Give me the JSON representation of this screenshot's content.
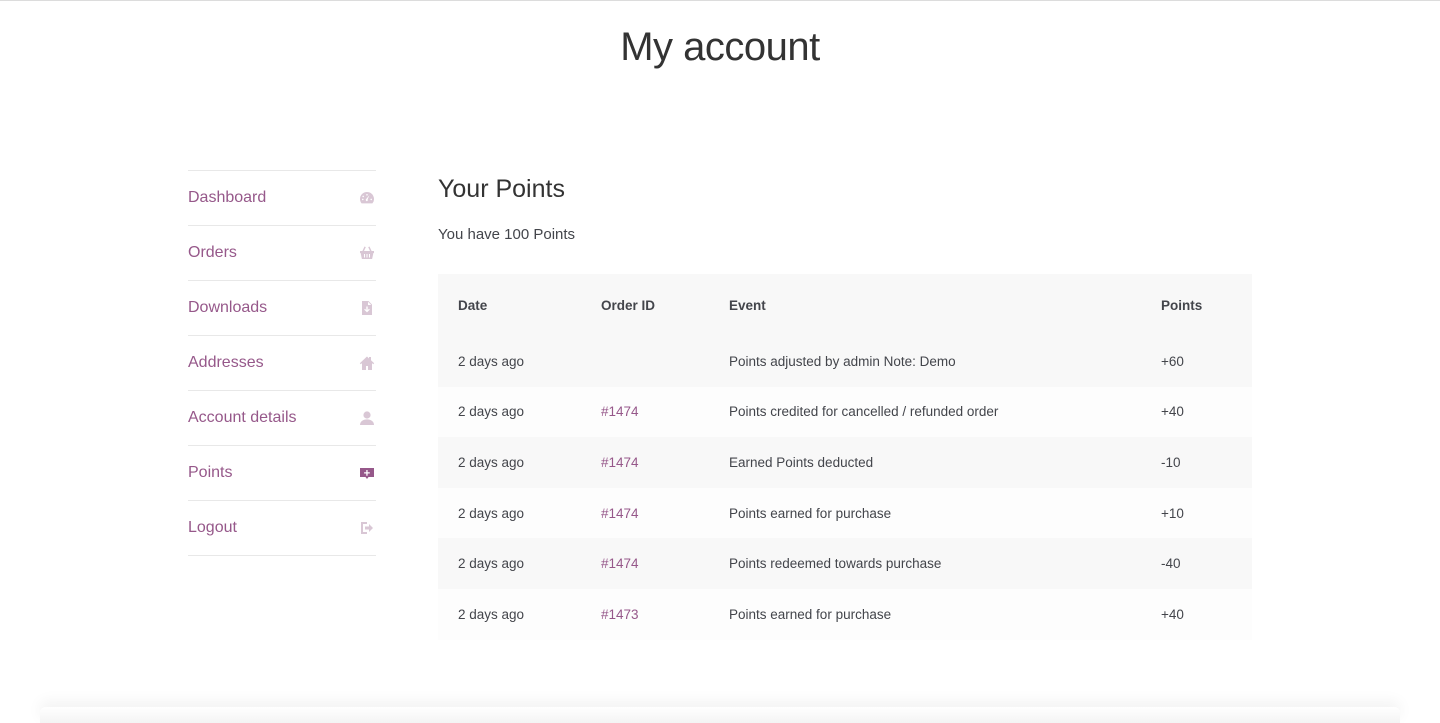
{
  "page": {
    "title": "My account"
  },
  "nav": {
    "items": [
      {
        "label": "Dashboard",
        "icon": "dashboard-icon"
      },
      {
        "label": "Orders",
        "icon": "basket-icon"
      },
      {
        "label": "Downloads",
        "icon": "file-download-icon"
      },
      {
        "label": "Addresses",
        "icon": "home-icon"
      },
      {
        "label": "Account details",
        "icon": "user-icon"
      },
      {
        "label": "Points",
        "icon": "points-icon",
        "active": true
      },
      {
        "label": "Logout",
        "icon": "logout-icon"
      }
    ]
  },
  "points": {
    "title": "Your Points",
    "summary": "You have 100 Points",
    "columns": [
      "Date",
      "Order ID",
      "Event",
      "Points"
    ],
    "rows": [
      {
        "date": "2 days ago",
        "order": "",
        "event": "Points adjusted by admin Note: Demo",
        "points": "+60"
      },
      {
        "date": "2 days ago",
        "order": "#1474",
        "event": "Points credited for cancelled / refunded order",
        "points": "+40"
      },
      {
        "date": "2 days ago",
        "order": "#1474",
        "event": "Earned Points deducted",
        "points": "-10"
      },
      {
        "date": "2 days ago",
        "order": "#1474",
        "event": "Points earned for purchase",
        "points": "+10"
      },
      {
        "date": "2 days ago",
        "order": "#1474",
        "event": "Points redeemed towards purchase",
        "points": "-40"
      },
      {
        "date": "2 days ago",
        "order": "#1473",
        "event": "Points earned for purchase",
        "points": "+40"
      }
    ]
  },
  "colors": {
    "accent": "#96588a",
    "icon_muted": "#d9c7d5",
    "text": "#43454b",
    "table_header_bg": "#f8f8f8"
  }
}
